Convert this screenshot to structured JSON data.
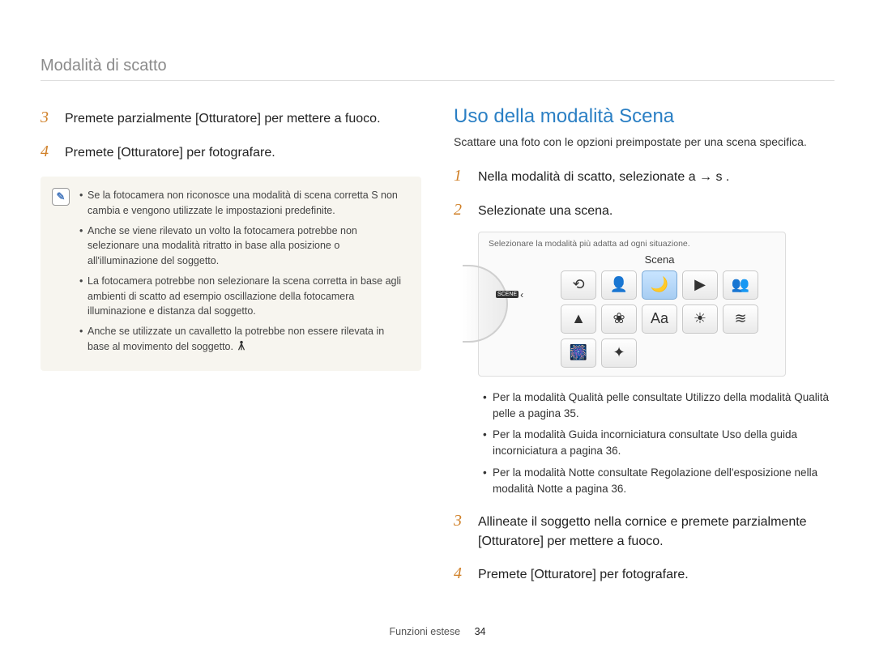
{
  "header": {
    "title": "Modalità di scatto"
  },
  "left": {
    "step3": {
      "num": "3",
      "text": "Premete parzialmente [Otturatore] per mettere a fuoco."
    },
    "step4": {
      "num": "4",
      "text": "Premete [Otturatore] per fotografare."
    },
    "note_icon": "✎",
    "notes": {
      "0": "Se la fotocamera non riconosce una modalità di scena corretta S non cambia e vengono utilizzate le impostazioni predefinite.",
      "1": "Anche se viene rilevato un volto la fotocamera potrebbe non selezionare una modalità ritratto in base alla posizione o all'illuminazione del soggetto.",
      "2": "La fotocamera potrebbe non selezionare la scena corretta in base agli ambienti di scatto ad esempio oscillazione della fotocamera illuminazione e distanza dal soggetto.",
      "3": "Anche se utilizzate un cavalletto la    potrebbe non essere rilevata in base al movimento del soggetto."
    }
  },
  "right": {
    "title": "Uso della modalità Scena",
    "subtitle": "Scattare una foto con le opzioni preimpostate per una scena specifica.",
    "step1": {
      "num": "1",
      "text": "Nella modalità di scatto, selezionate a    → s   ."
    },
    "step2": {
      "num": "2",
      "text": "Selezionate una scena."
    },
    "scene_hint": "Selezionare la modalità più adatta ad ogni situazione.",
    "scene_title": "Scena",
    "scene_badge": "SCENE",
    "bullets": {
      "0": "Per la modalità Qualità pelle consultate Utilizzo della modalità Qualità pelle a pagina 35.",
      "1": "Per la modalità Guida incorniciatura consultate Uso della guida incorniciatura a pagina 36.",
      "2": "Per la modalità Notte consultate Regolazione dell'esposizione nella modalità Notte a pagina 36."
    },
    "step3": {
      "num": "3",
      "text": "Allineate il soggetto nella cornice e premete parzialmente [Otturatore] per mettere a fuoco."
    },
    "step4": {
      "num": "4",
      "text": "Premete [Otturatore] per fotografare."
    },
    "icons": {
      "0": "⟲",
      "1": "👤",
      "2": "🌙",
      "3": "▶",
      "4": "👥",
      "5": "▲",
      "6": "❀",
      "7": "Aa",
      "8": "☀",
      "9": "≋",
      "10": "🎆",
      "11": "✦"
    },
    "selected_index": 2
  },
  "footer": {
    "section": "Funzioni estese",
    "page": "34"
  }
}
